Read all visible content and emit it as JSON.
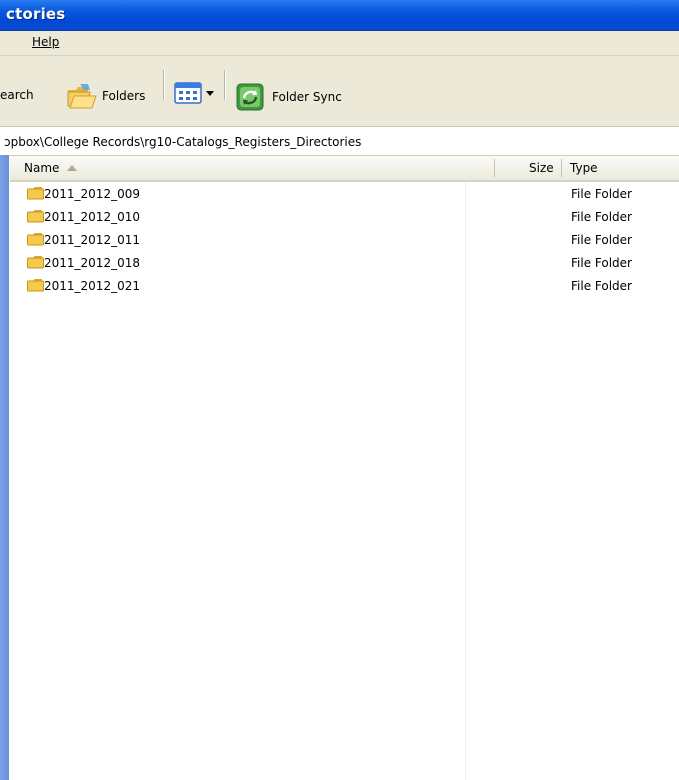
{
  "window": {
    "title": "ctories"
  },
  "menubar": {
    "help": "Help"
  },
  "toolbar": {
    "search_label": "earch",
    "folders_label": "Folders",
    "views_icon": "views-icon",
    "folder_sync_label": "Folder Sync"
  },
  "address": {
    "path": "ɔpbox\\College Records\\rg10-Catalogs_Registers_Directories"
  },
  "columns": {
    "name": "Name",
    "size": "Size",
    "type": "Type"
  },
  "items": [
    {
      "name": "2011_2012_009",
      "type": "File Folder"
    },
    {
      "name": "2011_2012_010",
      "type": "File Folder"
    },
    {
      "name": "2011_2012_011",
      "type": "File Folder"
    },
    {
      "name": "2011_2012_018",
      "type": "File Folder"
    },
    {
      "name": "2011_2012_021",
      "type": "File Folder"
    }
  ],
  "colors": {
    "titlebar": "#0a5ae0",
    "chrome": "#ece9d8",
    "folder": "#f3c94e",
    "left_strip": "#7ba2e7"
  }
}
